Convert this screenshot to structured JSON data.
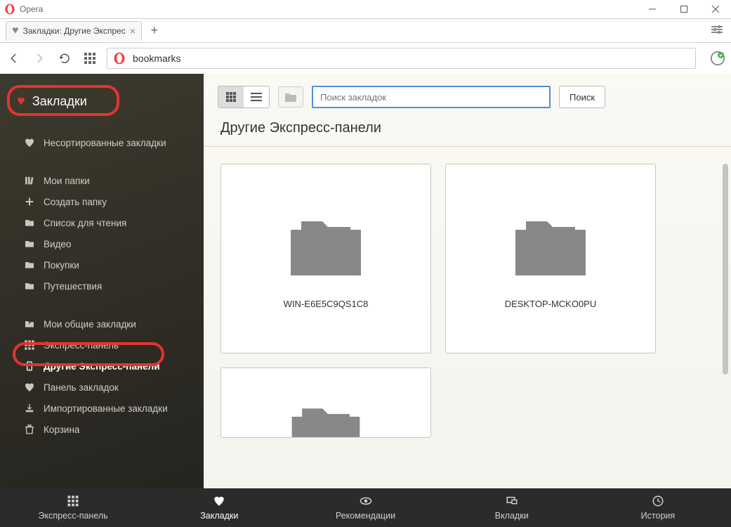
{
  "window": {
    "app_name": "Opera"
  },
  "tab": {
    "title": "Закладки: Другие Экспрес"
  },
  "address_bar": {
    "url_text": "bookmarks"
  },
  "sidebar": {
    "title": "Закладки",
    "section1": [
      {
        "label": "Несортированные закладки",
        "icon": "heart-icon"
      }
    ],
    "section2": [
      {
        "label": "Мои папки",
        "icon": "books-icon"
      },
      {
        "label": "Создать папку",
        "icon": "plus-icon"
      },
      {
        "label": "Список для чтения",
        "icon": "folder-icon"
      },
      {
        "label": "Видео",
        "icon": "folder-icon"
      },
      {
        "label": "Покупки",
        "icon": "folder-icon"
      },
      {
        "label": "Путешествия",
        "icon": "folder-icon"
      }
    ],
    "section3": [
      {
        "label": "Мои общие закладки",
        "icon": "share-icon"
      },
      {
        "label": "Экспресс-панель",
        "icon": "speeddial-icon"
      },
      {
        "label": "Другие Экспресс-панели",
        "icon": "device-icon",
        "selected": true
      },
      {
        "label": "Панель закладок",
        "icon": "heart-icon"
      },
      {
        "label": "Импортированные закладки",
        "icon": "import-icon"
      },
      {
        "label": "Корзина",
        "icon": "trash-icon"
      }
    ]
  },
  "main": {
    "search_placeholder": "Поиск закладок",
    "search_button": "Поиск",
    "heading": "Другие Экспресс-панели",
    "cards": [
      {
        "label": "WIN-E6E5C9QS1C8"
      },
      {
        "label": "DESKTOP-MCKO0PU"
      }
    ]
  },
  "bottom_nav": [
    {
      "label": "Экспресс-панель",
      "icon": "speeddial-icon"
    },
    {
      "label": "Закладки",
      "icon": "heart-icon",
      "active": true
    },
    {
      "label": "Рекомендации",
      "icon": "eye-icon"
    },
    {
      "label": "Вкладки",
      "icon": "monitor-icon"
    },
    {
      "label": "История",
      "icon": "clock-icon"
    }
  ]
}
